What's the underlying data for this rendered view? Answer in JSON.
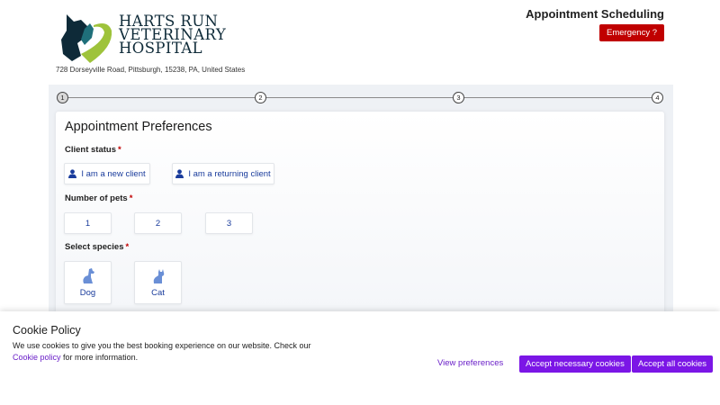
{
  "header": {
    "logo_lines": [
      "HARTS RUN",
      "VETERINARY",
      "HOSPITAL"
    ],
    "address": "728 Dorseyville Road, Pittsburgh, 15238, PA, United States",
    "page_title": "Appointment Scheduling",
    "emergency_label": "Emergency ?"
  },
  "stepper": {
    "steps": [
      "1",
      "2",
      "3",
      "4"
    ],
    "active_step": 1
  },
  "form": {
    "title": "Appointment Preferences",
    "required_marker": "*",
    "client_status": {
      "label": "Client status",
      "options": [
        "I am a new client",
        "I am a returning client"
      ]
    },
    "pets": {
      "label": "Number of pets",
      "options": [
        "1",
        "2",
        "3"
      ]
    },
    "species": {
      "label": "Select species",
      "options": [
        "Dog",
        "Cat"
      ]
    }
  },
  "cookie": {
    "title": "Cookie Policy",
    "text": "We use cookies to give you the best booking experience on our website. Check our",
    "link_label": "Cookie policy",
    "text_after": "for more information.",
    "view_preferences": "View preferences",
    "accept_necessary": "Accept necessary cookies",
    "accept_all": "Accept all cookies"
  },
  "colors": {
    "accent_purple": "#7b16e6",
    "emergency_red": "#c00000",
    "option_blue": "#1a3c9c",
    "logo_navy": "#0e2a38",
    "logo_green": "#9ec33b"
  }
}
